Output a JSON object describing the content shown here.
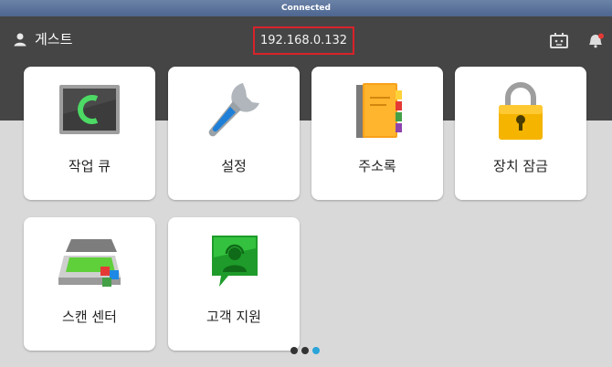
{
  "titlebar": {
    "status": "Connected"
  },
  "header": {
    "user_name": "게스트",
    "ip_address": "192.168.0.132",
    "icons": [
      "device-status-icon",
      "notification-bell-icon"
    ]
  },
  "tiles": [
    {
      "label": "작업 큐",
      "icon": "job-queue-monitor-icon"
    },
    {
      "label": "설정",
      "icon": "wrench-icon"
    },
    {
      "label": "주소록",
      "icon": "address-book-icon"
    },
    {
      "label": "장치 잠금",
      "icon": "padlock-icon"
    },
    {
      "label": "스캔 센터",
      "icon": "scanner-icon"
    },
    {
      "label": "고객 지원",
      "icon": "support-chat-icon"
    }
  ],
  "pagination": {
    "total": 3,
    "current": 3
  },
  "colors": {
    "highlight_border": "#d8222a",
    "active_dot": "#2aa3d8",
    "header_bg": "#454545"
  }
}
